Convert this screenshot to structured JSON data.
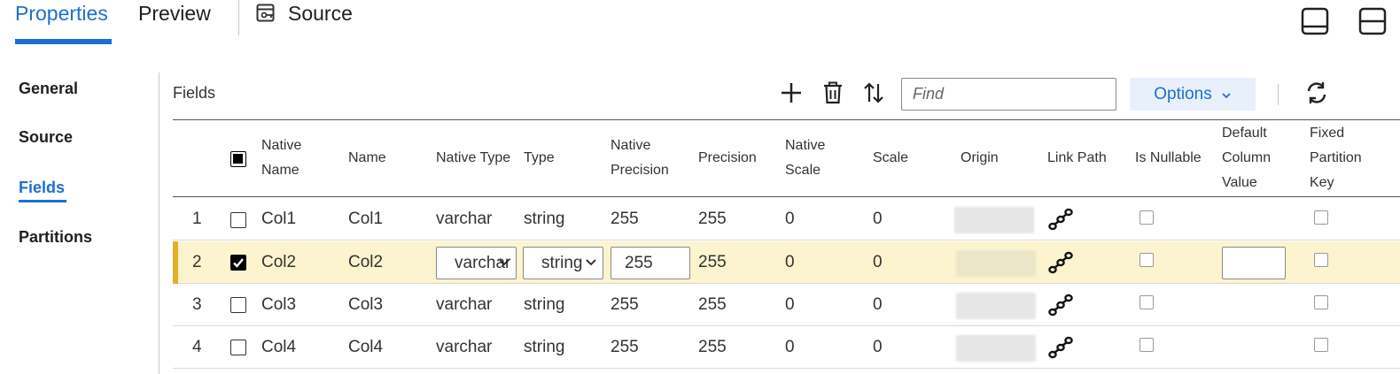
{
  "tabs": {
    "properties": "Properties",
    "preview": "Preview",
    "source": "Source"
  },
  "nav": {
    "general": "General",
    "source": "Source",
    "fields": "Fields",
    "partitions": "Partitions"
  },
  "toolbar": {
    "title": "Fields",
    "find_placeholder": "Find",
    "options_label": "Options"
  },
  "columns": {
    "native_name": [
      "Native",
      "Name"
    ],
    "name": "Name",
    "native_type": "Native Type",
    "type": "Type",
    "native_precision": [
      "Native",
      "Precision"
    ],
    "precision": "Precision",
    "native_scale": [
      "Native",
      "Scale"
    ],
    "scale": "Scale",
    "origin": "Origin",
    "link_path": "Link Path",
    "is_nullable": "Is Nullable",
    "default_value": [
      "Default",
      "Column",
      "Value"
    ],
    "fixed_partition_key": [
      "Fixed",
      "Partition",
      "Key"
    ]
  },
  "rows": [
    {
      "num": "1",
      "native_name": "Col1",
      "name": "Col1",
      "native_type": "varchar",
      "type": "string",
      "native_precision": "255",
      "precision": "255",
      "native_scale": "0",
      "scale": "0",
      "checked": false
    },
    {
      "num": "2",
      "native_name": "Col2",
      "name": "Col2",
      "native_type": "varchar",
      "type": "string",
      "native_precision": "255",
      "precision": "255",
      "native_scale": "0",
      "scale": "0",
      "checked": true
    },
    {
      "num": "3",
      "native_name": "Col3",
      "name": "Col3",
      "native_type": "varchar",
      "type": "string",
      "native_precision": "255",
      "precision": "255",
      "native_scale": "0",
      "scale": "0",
      "checked": false
    },
    {
      "num": "4",
      "native_name": "Col4",
      "name": "Col4",
      "native_type": "varchar",
      "type": "string",
      "native_precision": "255",
      "precision": "255",
      "native_scale": "0",
      "scale": "0",
      "checked": false
    }
  ],
  "colors": {
    "accent": "#1e6fd0",
    "selected_row": "#fbf4cf",
    "selected_marker": "#e0b12a"
  }
}
